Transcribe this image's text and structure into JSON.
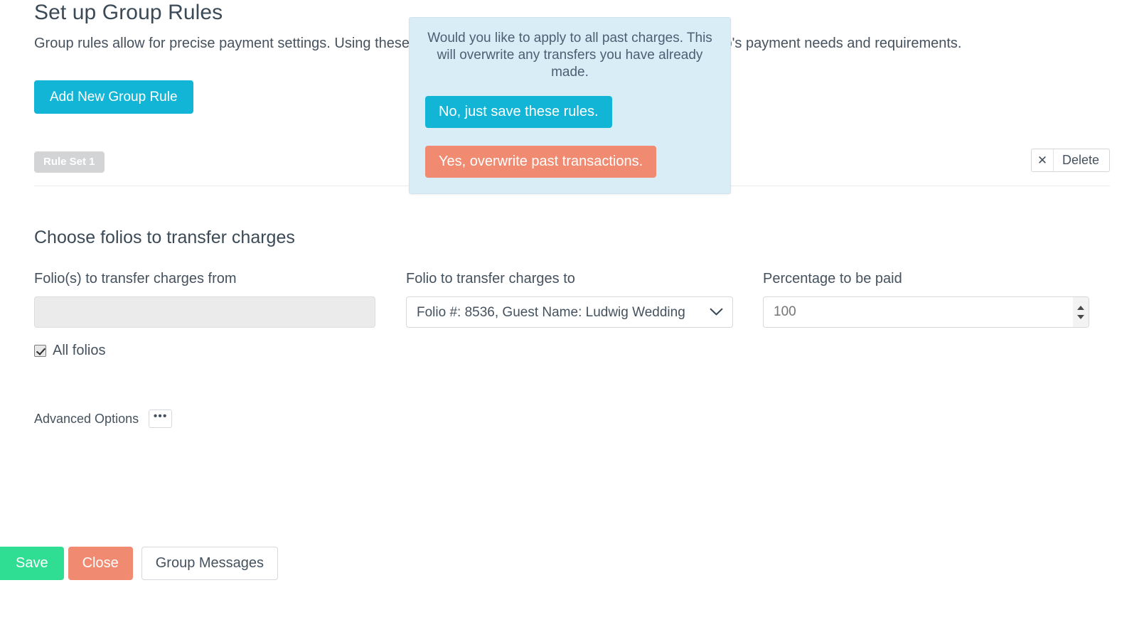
{
  "header": {
    "title": "Set up Group Rules",
    "description": "Group rules allow for precise payment settings. Using these settings you can tailor payment rules to your group's payment needs and requirements.",
    "add_rule_label": "Add New Group Rule"
  },
  "ruleset": {
    "tab_label": "Rule Set 1",
    "delete_label": "Delete",
    "delete_icon": "close-icon"
  },
  "section": {
    "title": "Choose folios to transfer charges"
  },
  "fields": {
    "from": {
      "label": "Folio(s) to transfer charges from",
      "value": "",
      "placeholder": ""
    },
    "to": {
      "label": "Folio to transfer charges to",
      "selected": "Folio #: 8536, Guest Name: Ludwig Wedding",
      "options": [
        "Folio #: 8536, Guest Name: Ludwig Wedding"
      ],
      "chevron_icon": "chevron-down-icon"
    },
    "percentage": {
      "label": "Percentage to be paid",
      "value": "",
      "placeholder": "100",
      "spinner_up_icon": "caret-up-icon",
      "spinner_down_icon": "caret-down-icon"
    }
  },
  "all_folios": {
    "label": "All folios",
    "checked": true
  },
  "advanced": {
    "label": "Advanced Options",
    "button_label": "•••",
    "button_icon": "ellipsis-icon"
  },
  "footer": {
    "save_label": "Save",
    "close_label": "Close",
    "group_messages_label": "Group Messages"
  },
  "popover": {
    "message": "Would you like to apply to all past charges. This will overwrite any transfers you have already made.",
    "no_label": "No, just save these rules.",
    "yes_label": "Yes, overwrite past transactions."
  },
  "colors": {
    "accent_cyan": "#12b5d6",
    "salmon": "#f08a70",
    "green": "#2fdd93",
    "popover_bg": "#d9edf7",
    "tab_gray": "#d3d4d6",
    "text": "#45525e"
  }
}
